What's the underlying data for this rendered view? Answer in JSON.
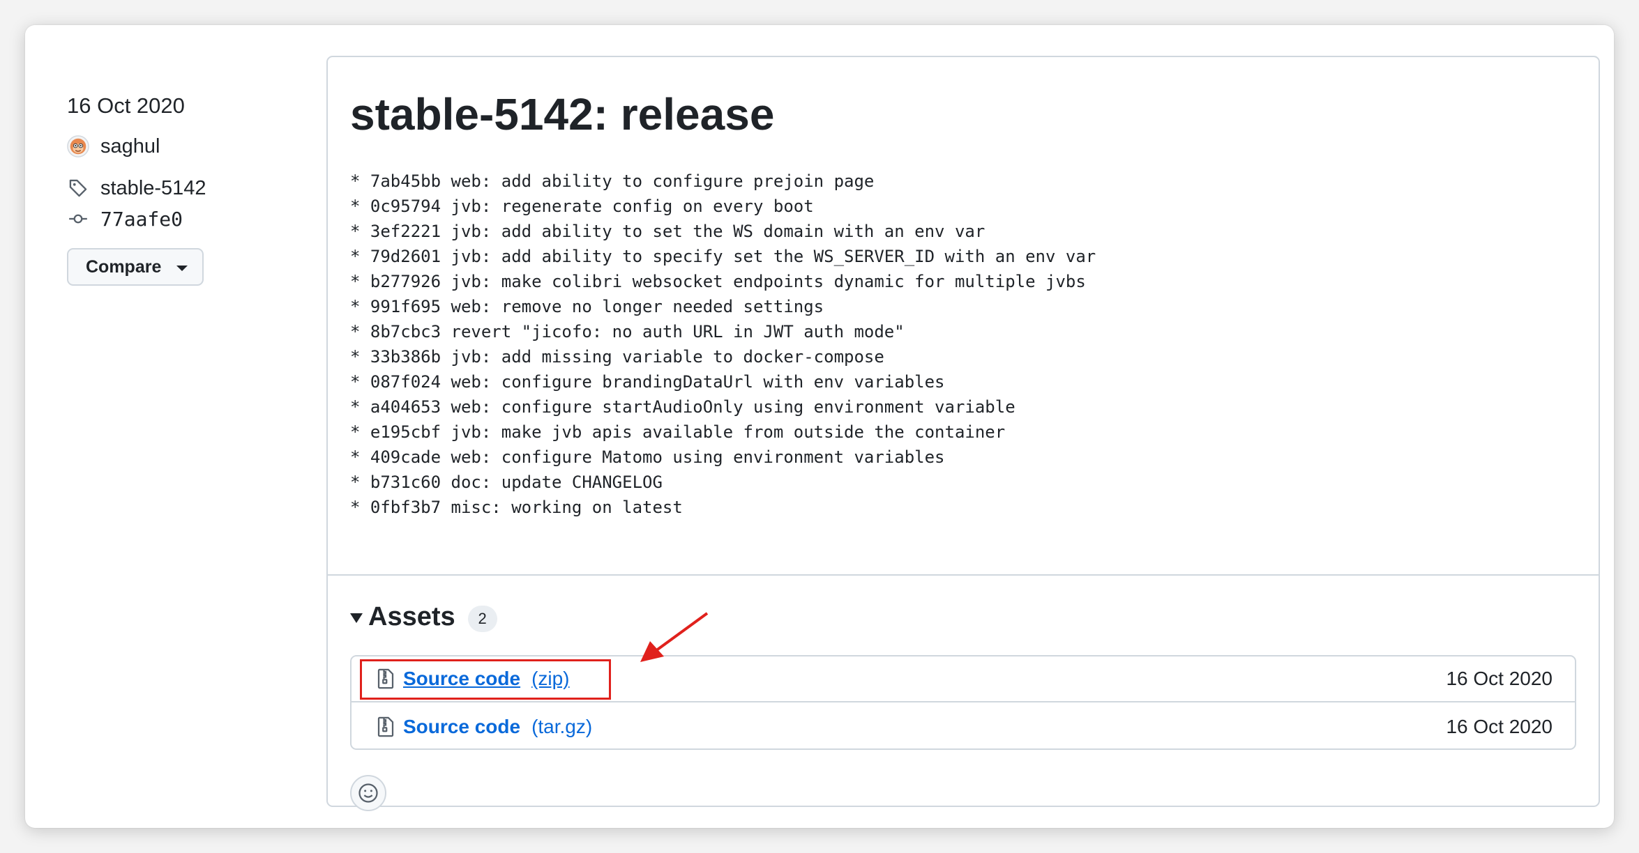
{
  "meta": {
    "date": "16 Oct 2020",
    "author": "saghul",
    "tag": "stable-5142",
    "commit": "77aafe0",
    "compare_label": "Compare"
  },
  "release": {
    "title": "stable-5142: release",
    "notes": [
      "* 7ab45bb web: add ability to configure prejoin page",
      "* 0c95794 jvb: regenerate config on every boot",
      "* 3ef2221 jvb: add ability to set the WS domain with an env var",
      "* 79d2601 jvb: add ability to specify set the WS_SERVER_ID with an env var",
      "* b277926 jvb: make colibri websocket endpoints dynamic for multiple jvbs",
      "* 991f695 web: remove no longer needed settings",
      "* 8b7cbc3 revert \"jicofo: no auth URL in JWT auth mode\"",
      "* 33b386b jvb: add missing variable to docker-compose",
      "* 087f024 web: configure brandingDataUrl with env variables",
      "* a404653 web: configure startAudioOnly using environment variable",
      "* e195cbf jvb: make jvb apis available from outside the container",
      "* 409cade web: configure Matomo using environment variables",
      "* b731c60 doc: update CHANGELOG",
      "* 0fbf3b7 misc: working on latest"
    ]
  },
  "assets": {
    "label": "Assets",
    "count": "2",
    "items": [
      {
        "name": "Source code",
        "ext": "(zip)",
        "date": "16 Oct 2020"
      },
      {
        "name": "Source code",
        "ext": "(tar.gz)",
        "date": "16 Oct 2020"
      }
    ]
  },
  "colors": {
    "link": "#0969da",
    "annotation": "#e0211c",
    "border": "#d0d7de"
  },
  "icons": {
    "author": "avatar",
    "tag": "tag-icon",
    "commit": "git-commit-icon",
    "asset": "file-zip-icon",
    "reaction": "smiley-icon"
  }
}
